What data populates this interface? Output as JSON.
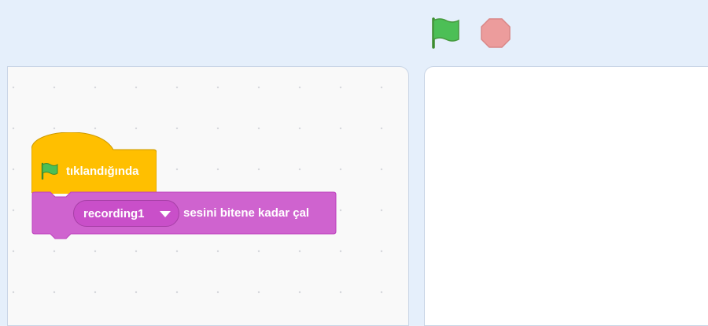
{
  "toolbar": {
    "green_flag_icon": "green-flag-icon",
    "stop_icon": "stop-sign-icon",
    "green_flag_color": "#4cbf56",
    "stop_color": "#ec9c9c"
  },
  "script": {
    "hat_block": {
      "icon": "green-flag-icon",
      "label": "tıklandığında",
      "color": "#ffbf00"
    },
    "sound_block": {
      "sound_name": "recording1",
      "label": "sesini bitene kadar çal",
      "color": "#cf63cf"
    }
  }
}
